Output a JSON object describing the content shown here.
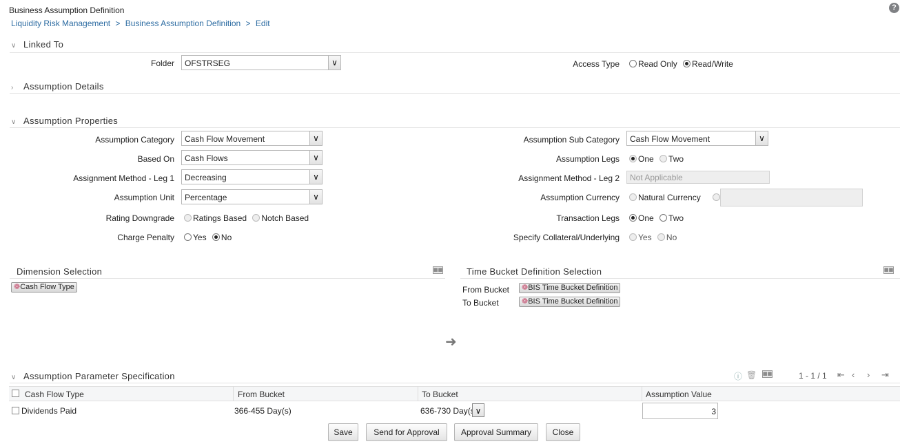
{
  "header": {
    "title": "Business Assumption Definition",
    "help": "?",
    "breadcrumb": [
      "Liquidity Risk Management",
      "Business Assumption Definition",
      "Edit"
    ],
    "separator": ">"
  },
  "linked_to": {
    "section_title": "Linked To",
    "folder_label": "Folder",
    "folder_value": "OFSTRSEG",
    "access_type_label": "Access Type",
    "access_options": [
      "Read Only",
      "Read/Write"
    ],
    "access_selected": "Read/Write"
  },
  "assumption_details": {
    "section_title": "Assumption Details"
  },
  "properties": {
    "section_title": "Assumption Properties",
    "category_label": "Assumption Category",
    "category_value": "Cash Flow Movement",
    "based_on_label": "Based On",
    "based_on_value": "Cash Flows",
    "leg1_label": "Assignment Method - Leg 1",
    "leg1_value": "Decreasing",
    "unit_label": "Assumption Unit",
    "unit_value": "Percentage",
    "rating_label": "Rating Downgrade",
    "rating_options": [
      "Ratings Based",
      "Notch Based"
    ],
    "penalty_label": "Charge Penalty",
    "penalty_options": [
      "Yes",
      "No"
    ],
    "penalty_selected": "No",
    "sub_category_label": "Assumption Sub Category",
    "sub_category_value": "Cash Flow Movement",
    "legs_label": "Assumption Legs",
    "legs_options": [
      "One",
      "Two"
    ],
    "legs_selected": "One",
    "leg2_label": "Assignment Method - Leg 2",
    "leg2_value": "Not Applicable",
    "currency_label": "Assumption Currency",
    "currency_option": "Natural Currency",
    "currency_value": "",
    "tx_legs_label": "Transaction Legs",
    "tx_legs_options": [
      "One",
      "Two"
    ],
    "tx_legs_selected": "One",
    "collateral_label": "Specify Collateral/Underlying",
    "collateral_options": [
      "Yes",
      "No"
    ]
  },
  "dimension_selection": {
    "title": "Dimension Selection",
    "items": [
      "Cash Flow Type"
    ]
  },
  "time_bucket": {
    "title": "Time Bucket Definition Selection",
    "from_label": "From Bucket",
    "from_value": "BIS Time Bucket Definition",
    "to_label": "To Bucket",
    "to_value": "BIS Time Bucket Definition"
  },
  "parameters": {
    "section_title": "Assumption Parameter Specification",
    "pager": "1 - 1 / 1",
    "columns": [
      "Cash Flow Type",
      "From Bucket",
      "To Bucket",
      "Assumption Value"
    ],
    "rows": [
      {
        "cash_flow_type": "Dividends Paid",
        "from_bucket": "366-455 Day(s)",
        "to_bucket": "636-730 Day(s)",
        "value": "3"
      }
    ]
  },
  "actions": {
    "save": "Save",
    "send": "Send for Approval",
    "summary": "Approval Summary",
    "close": "Close"
  },
  "colors": {
    "link": "#2d6ca2",
    "hierarchy_icon": "#c44f6f"
  }
}
